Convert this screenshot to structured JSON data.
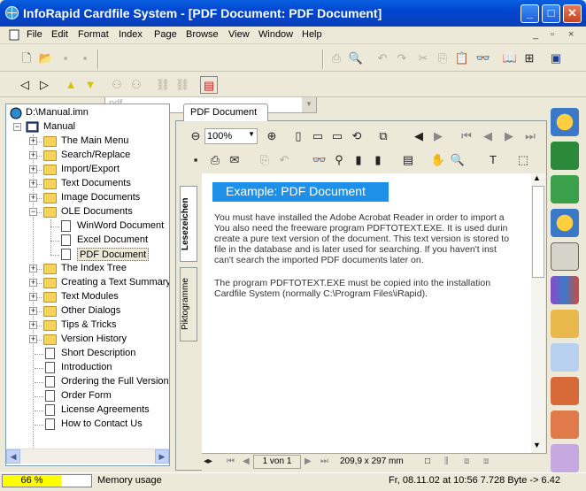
{
  "window": {
    "title": "InfoRapid Cardfile System - [PDF Document: PDF Document]"
  },
  "menu": [
    "File",
    "Edit",
    "Format",
    "Index",
    "Page",
    "Browse",
    "View",
    "Window",
    "Help"
  ],
  "toolbar": {
    "combo_value": "pdf"
  },
  "tree": {
    "root": "D:\\Manual.imn",
    "manual": "Manual",
    "items": [
      "The Main Menu",
      "Search/Replace",
      "Import/Export",
      "Text Documents",
      "Image Documents",
      "OLE Documents"
    ],
    "ole_children": [
      "WinWord Document",
      "Excel Document",
      "PDF Document"
    ],
    "items2": [
      "The Index Tree",
      "Creating a Text Summary",
      "Text Modules",
      "Other Dialogs",
      "Tips & Tricks",
      "Version History"
    ],
    "docs": [
      "Short Description",
      "Introduction",
      "Ordering the Full Version",
      "Order Form",
      "License Agreements",
      "How to Contact Us"
    ]
  },
  "doc": {
    "tab": "PDF Document",
    "side_tabs": [
      "Lesezeichen",
      "Piktogramme"
    ],
    "zoom": "100%",
    "heading": "Example: PDF Document",
    "para1": [
      "You must have installed the Adobe Acrobat Reader in order to import a",
      "You also need the freeware program PDFTOTEXT.EXE. It is used durin",
      "create a pure text version of the document. This text version is stored to",
      "file in the database and is later used for searching. If you haven't inst",
      "can't search the imported PDF documents later on."
    ],
    "para2": [
      "The program PDFTOTEXT.EXE must be copied into the installation",
      "Cardfile System (normally C:\\Program Files\\iRapid)."
    ],
    "page_indicator": "1 von 1",
    "page_size": "209,9 x 297 mm"
  },
  "status": {
    "progress_label": "66 %",
    "progress_value": 0.66,
    "memory_label": "Memory usage",
    "info": "Fr, 08.11.02 at 10:56 7.728 Byte -> 6.42"
  }
}
